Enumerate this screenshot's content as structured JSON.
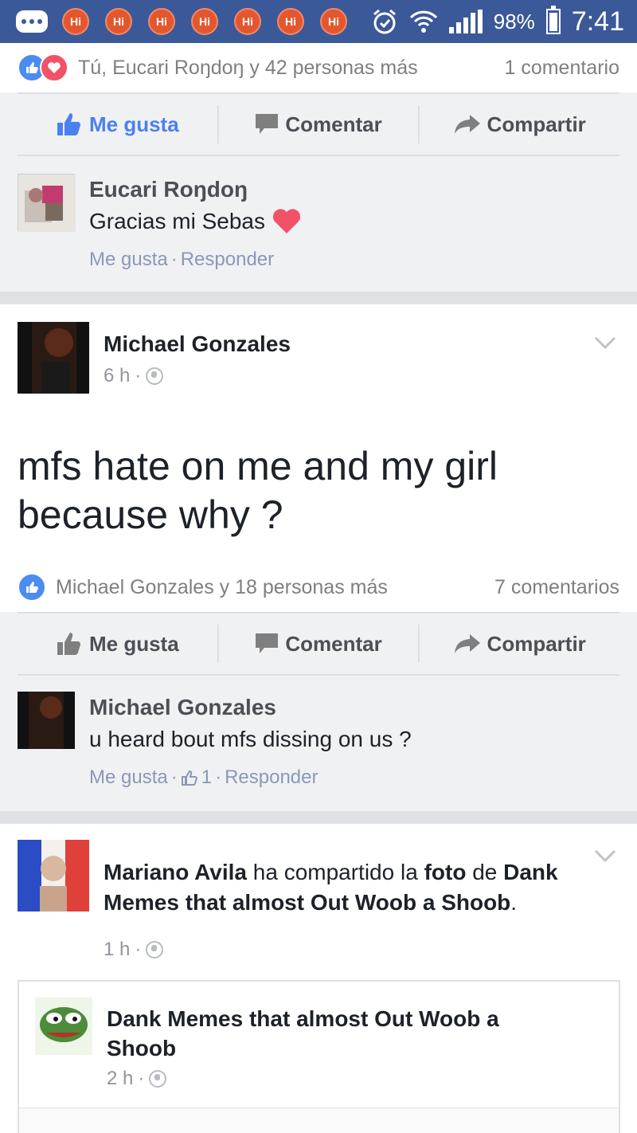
{
  "statusbar": {
    "battery": "98%",
    "time": "7:41",
    "notif_badge": "Hi"
  },
  "post1": {
    "reactions": "Tú, Eucari Roŋdoŋ y 42 personas más",
    "comments": "1 comentario",
    "actions": {
      "like": "Me gusta",
      "comment": "Comentar",
      "share": "Compartir"
    },
    "comment": {
      "name": "Eucari Roŋdoŋ",
      "text": "Gracias mi Sebas",
      "like": "Me gusta",
      "reply": "Responder",
      "sep": "·"
    }
  },
  "post2": {
    "author": "Michael Gonzales",
    "time": "6 h",
    "dot": "·",
    "text": "mfs hate on me and my girl because why ?",
    "reactions": "Michael Gonzales y 18 personas más",
    "comments": "7 comentarios",
    "actions": {
      "like": "Me gusta",
      "comment": "Comentar",
      "share": "Compartir"
    },
    "comment": {
      "name": "Michael Gonzales",
      "text": "u heard bout mfs dissing on us ?",
      "like": "Me gusta",
      "like_count": "1",
      "reply": "Responder",
      "sep": "·"
    }
  },
  "post3": {
    "author": "Mariano Avila",
    "verb": "ha compartido la",
    "object": "foto",
    "prep": "de",
    "page": "Dank Memes that almost Out Woob a Shoob",
    "period": ".",
    "time": "1 h",
    "dot": "·",
    "shared": {
      "page": "Dank Memes that almost Out Woob a Shoob",
      "time": "2 h",
      "dot": "·"
    }
  },
  "colors": {
    "brand": "#3b5998",
    "accent": "#4a80f0",
    "heart": "#f25268"
  }
}
